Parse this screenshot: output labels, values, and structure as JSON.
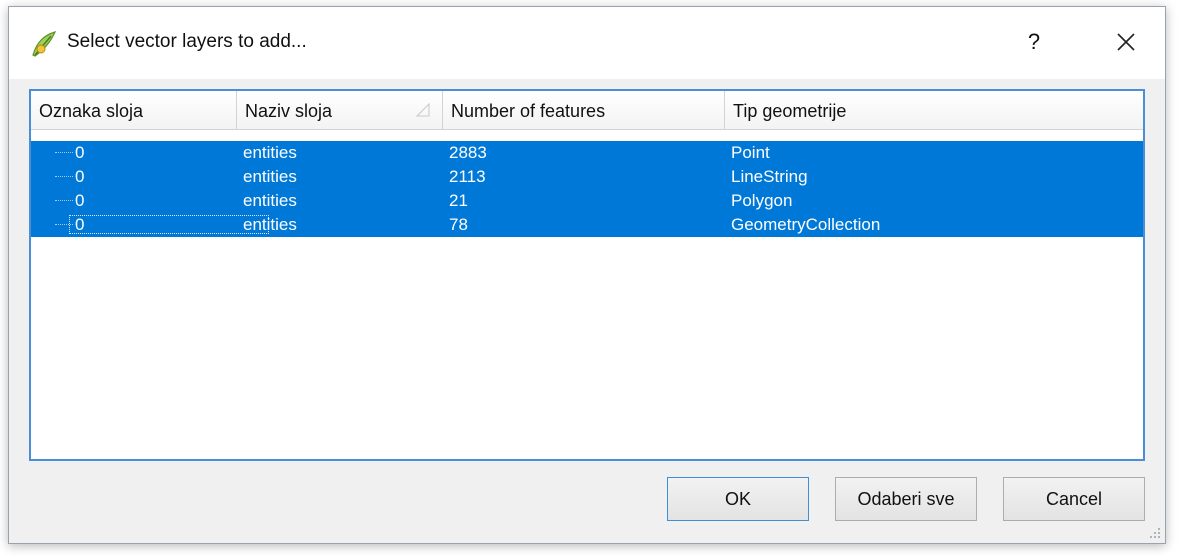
{
  "window": {
    "title": "Select vector layers to add...",
    "help_label": "?",
    "app_icon": "qgis-logo-icon",
    "close_icon": "close-icon"
  },
  "table": {
    "columns": [
      "Oznaka sloja",
      "Naziv sloja",
      "Number of features",
      "Tip geometrije"
    ],
    "sorted_column": "Naziv sloja",
    "selection_color": "#0078d7",
    "rows": [
      {
        "id": "0",
        "name": "entities",
        "features": "2883",
        "geometry": "Point"
      },
      {
        "id": "0",
        "name": "entities",
        "features": "2113",
        "geometry": "LineString"
      },
      {
        "id": "0",
        "name": "entities",
        "features": "21",
        "geometry": "Polygon"
      },
      {
        "id": "0",
        "name": "entities",
        "features": "78",
        "geometry": "GeometryCollection"
      }
    ]
  },
  "buttons": {
    "ok": "OK",
    "select_all": "Odaberi sve",
    "cancel": "Cancel"
  }
}
